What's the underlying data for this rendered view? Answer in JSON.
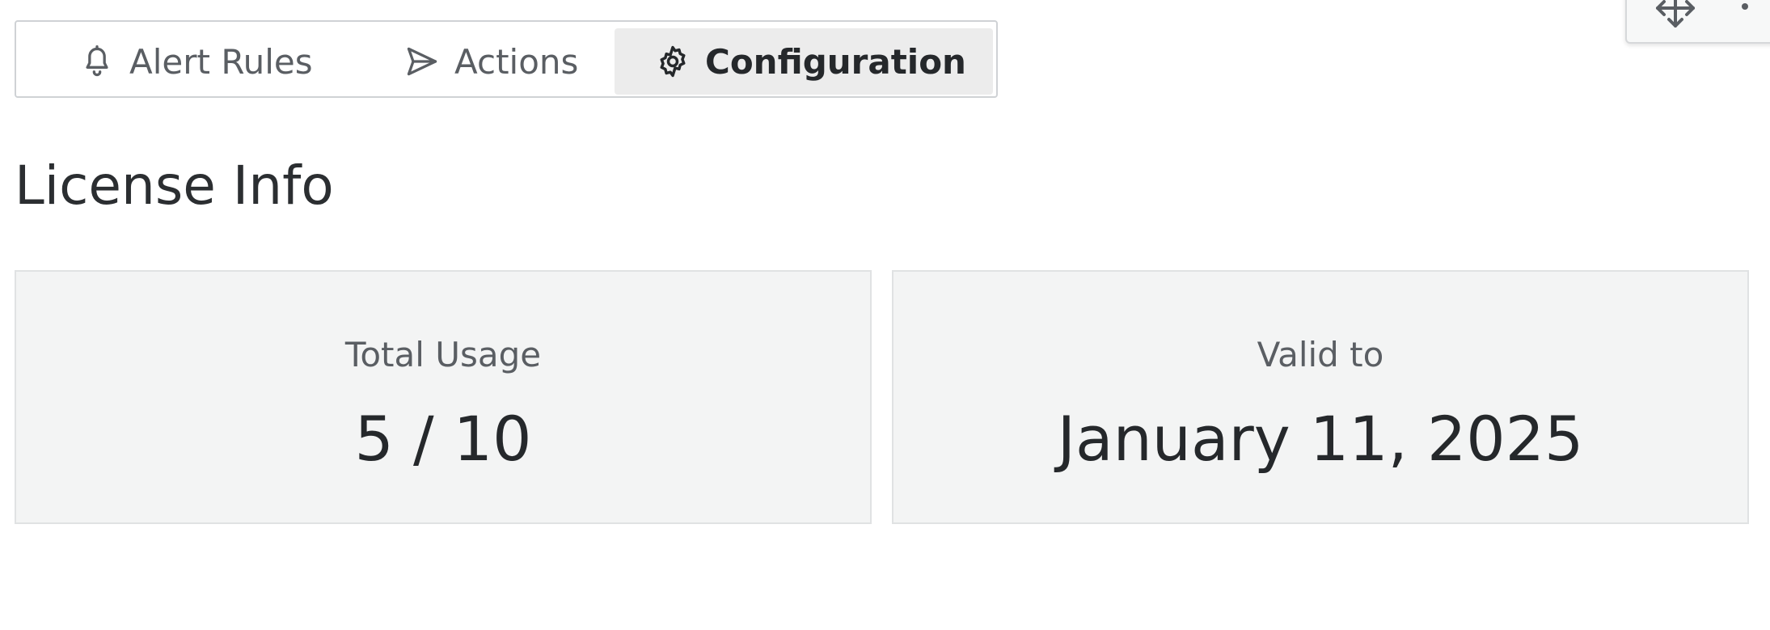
{
  "tabs": [
    {
      "label": "Alert Rules",
      "icon": "bell-icon",
      "active": false
    },
    {
      "label": "Actions",
      "icon": "send-icon",
      "active": false
    },
    {
      "label": "Configuration",
      "icon": "gear-icon",
      "active": true
    }
  ],
  "toolbar": {
    "move_icon": "move-arrows-icon",
    "more_icon": "more-vertical-icon"
  },
  "section": {
    "title": "License Info"
  },
  "cards": {
    "usage": {
      "label": "Total Usage",
      "value": "5 / 10"
    },
    "valid": {
      "label": "Valid to",
      "value": "January 11, 2025"
    }
  },
  "colors": {
    "active_tab_bg": "#ececec",
    "card_bg": "#f3f4f4",
    "text_primary": "#25282b",
    "text_secondary": "#5a5e63"
  }
}
